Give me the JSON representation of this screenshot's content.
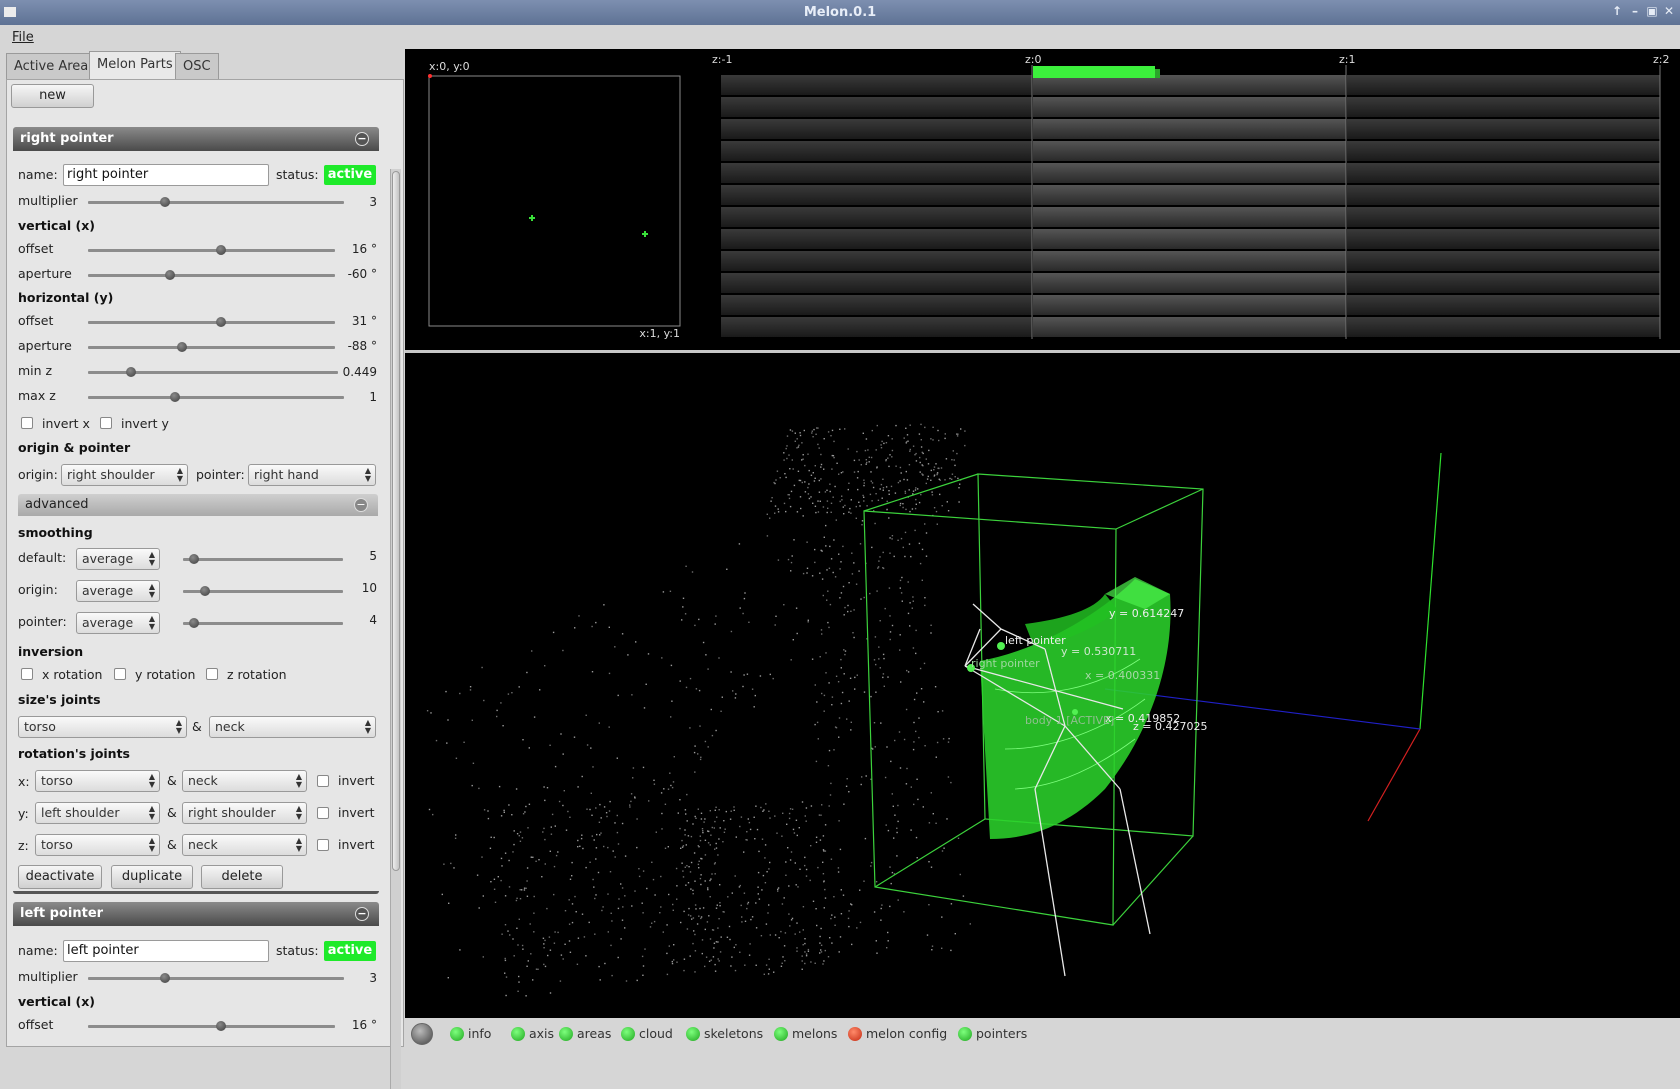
{
  "window": {
    "title": "Melon.0.1"
  },
  "menu": {
    "file": "File"
  },
  "tabs": [
    "Active Area",
    "Melon Parts",
    "OSC"
  ],
  "new_button": "new",
  "right_pointer": {
    "header": "right pointer",
    "name_label": "name:",
    "name_value": "right pointer",
    "status_label": "status:",
    "status_value": "active",
    "multiplier_label": "multiplier",
    "multiplier_value": "3",
    "vertical_title": "vertical (x)",
    "v_offset_label": "offset",
    "v_offset_value": "16 °",
    "v_aperture_label": "aperture",
    "v_aperture_value": "-60 °",
    "horizontal_title": "horizontal (y)",
    "h_offset_label": "offset",
    "h_offset_value": "31 °",
    "h_aperture_label": "aperture",
    "h_aperture_value": "-88 °",
    "minz_label": "min z",
    "minz_value": "0.449",
    "maxz_label": "max z",
    "maxz_value": "1",
    "invert_x": "invert x",
    "invert_y": "invert y",
    "origin_title": "origin & pointer",
    "origin_label": "origin:",
    "origin_value": "right shoulder",
    "pointer_label": "pointer:",
    "pointer_value": "right hand"
  },
  "advanced": {
    "header": "advanced",
    "smoothing_title": "smoothing",
    "default_label": "default:",
    "default_mode": "average",
    "default_value": "5",
    "origin_label": "origin:",
    "origin_mode": "average",
    "origin_value": "10",
    "pointer_label": "pointer:",
    "pointer_mode": "average",
    "pointer_value": "4",
    "inversion_title": "inversion",
    "x_rotation": "x rotation",
    "y_rotation": "y rotation",
    "z_rotation": "z rotation",
    "size_joints_title": "size's joints",
    "size_a": "torso",
    "amp": "&",
    "size_b": "neck",
    "rotation_joints_title": "rotation's joints",
    "rx_label": "x:",
    "rx_a": "torso",
    "rx_b": "neck",
    "ry_label": "y:",
    "ry_a": "left shoulder",
    "ry_b": "right shoulder",
    "rz_label": "z:",
    "rz_a": "torso",
    "rz_b": "neck",
    "invert": "invert"
  },
  "actions": {
    "deactivate": "deactivate",
    "duplicate": "duplicate",
    "delete": "delete"
  },
  "left_pointer": {
    "header": "left pointer",
    "name_label": "name:",
    "name_value": "left pointer",
    "status_label": "status:",
    "status_value": "active",
    "multiplier_label": "multiplier",
    "multiplier_value": "3",
    "vertical_title": "vertical (x)",
    "v_offset_label": "offset",
    "v_offset_value": "16 °"
  },
  "view2d": {
    "top_left": "x:0, y:0",
    "bottom_right": "x:1, y:1"
  },
  "depth": {
    "z_m1": "z:-1",
    "z_0": "z:0",
    "z_1": "z:1",
    "z_2": "z:2"
  },
  "scene": {
    "left_pointer": "left pointer",
    "right_pointer": "right pointer",
    "y1": "y = 0.614247",
    "y2": "y = 0.530711",
    "x1": "x = 0.400331",
    "x2": "x = 0.419852",
    "z1": "z = 0.427025",
    "body": "body 1 [ACTIVE]"
  },
  "toggles": [
    {
      "label": "info",
      "on": true
    },
    {
      "label": "axis",
      "on": true
    },
    {
      "label": "areas",
      "on": true
    },
    {
      "label": "cloud",
      "on": true
    },
    {
      "label": "skeletons",
      "on": true
    },
    {
      "label": "melons",
      "on": true
    },
    {
      "label": "melon config",
      "on": false
    },
    {
      "label": "pointers",
      "on": true
    }
  ],
  "sliders": {
    "rp_multiplier": 0.3,
    "rp_v_offset": 0.54,
    "rp_v_aperture": 0.33,
    "rp_h_offset": 0.54,
    "rp_h_aperture": 0.38,
    "rp_minz": 0.17,
    "rp_maxz": 0.34,
    "sm_default": 0.07,
    "sm_origin": 0.14,
    "sm_pointer": 0.07,
    "lp_multiplier": 0.3,
    "lp_v_offset": 0.54
  },
  "colors": {
    "active": "#1eea2a",
    "accent_green": "#2bf02b"
  }
}
